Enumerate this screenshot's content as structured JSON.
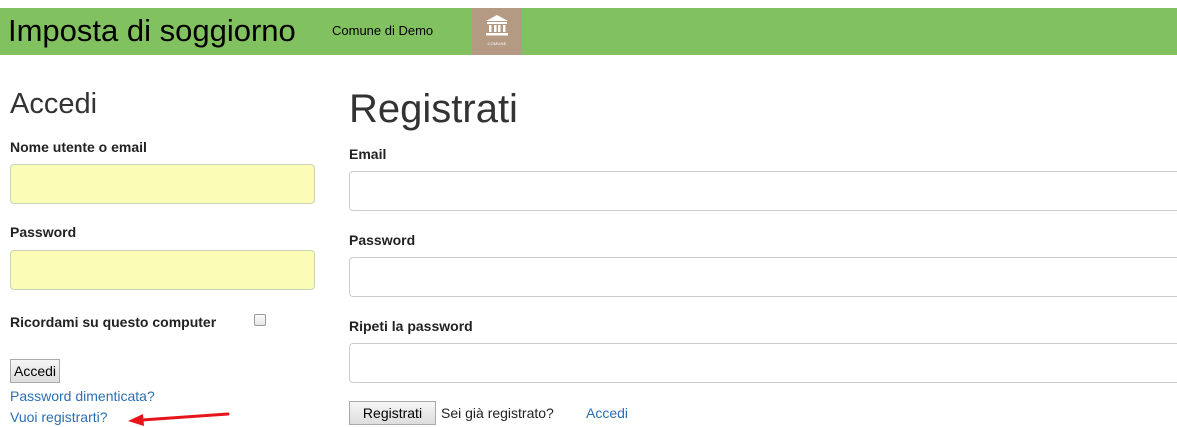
{
  "header": {
    "title": "Imposta di soggiorno",
    "subtitle": "Comune di Demo",
    "logo_icon": "municipality-building-icon",
    "logo_caption": "COMUNE",
    "background_color": "#82c160",
    "logo_background_color": "#b49a83"
  },
  "login": {
    "heading": "Accedi",
    "username_label": "Nome utente o email",
    "username_value": "",
    "password_label": "Password",
    "password_value": "",
    "remember_label": "Ricordami su questo computer",
    "remember_checked": false,
    "submit_label": "Accedi",
    "forgot_link": "Password dimenticata?",
    "register_link": "Vuoi registrarti?",
    "autofill_color": "#fbfcb6"
  },
  "register": {
    "heading": "Registrati",
    "email_label": "Email",
    "email_value": "",
    "password_label": "Password",
    "password_value": "",
    "repeat_label": "Ripeti la password",
    "repeat_value": "",
    "submit_label": "Registrati",
    "already_text": "Sei già registrato?",
    "login_link": "Accedi"
  },
  "annotation": {
    "arrow_color": "#e8141b",
    "arrow_icon": "red-arrow-icon"
  },
  "link_color": "#2a6fb5"
}
